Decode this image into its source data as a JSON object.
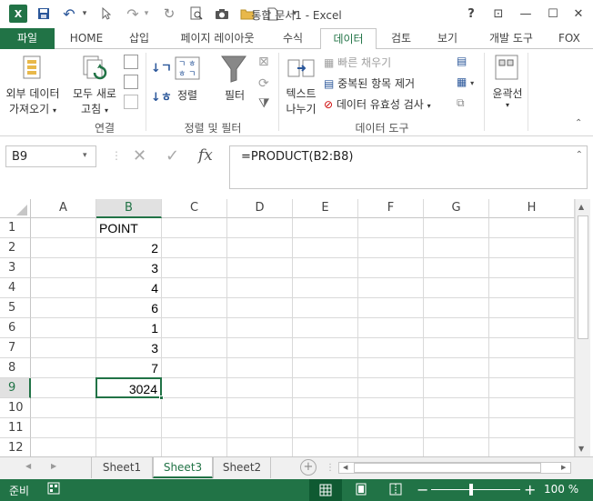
{
  "window": {
    "title": "통합 문서1 - Excel"
  },
  "qat": {
    "excel_icon": "X",
    "save_icon": "💾",
    "undo_icon": "↶",
    "redo_icon": "↷"
  },
  "window_controls": {
    "help": "?",
    "restore_ribbon": "⊡",
    "minimize": "—",
    "maximize": "☐",
    "close": "✕"
  },
  "tabs": [
    {
      "label": "파일"
    },
    {
      "label": "HOME"
    },
    {
      "label": "삽입"
    },
    {
      "label": "페이지 레이아웃"
    },
    {
      "label": "수식"
    },
    {
      "label": "데이터"
    },
    {
      "label": "검토"
    },
    {
      "label": "보기"
    },
    {
      "label": "개발 도구"
    },
    {
      "label": "FOX"
    }
  ],
  "ribbon": {
    "external_data": {
      "line1": "외부 데이터",
      "line2": "가져오기"
    },
    "refresh_all": {
      "line1": "모두 새로",
      "line2": "고침"
    },
    "sort": "정렬",
    "filter": "필터",
    "text_to_columns": {
      "line1": "텍스트",
      "line2": "나누기"
    },
    "flash_fill": "빠른 채우기",
    "remove_duplicates": "중복된 항목 제거",
    "data_validation": "데이터 유효성 검사",
    "outline": "윤곽선",
    "groups": {
      "connections": "연결",
      "sort_filter": "정렬 및 필터",
      "data_tools": "데이터 도구"
    }
  },
  "formula_bar": {
    "name_box": "B9",
    "formula": "=PRODUCT(B2:B8)",
    "cancel": "✕",
    "enter": "✓",
    "fx": "fx"
  },
  "grid": {
    "columns": [
      "A",
      "B",
      "C",
      "D",
      "E",
      "F",
      "G",
      "H"
    ],
    "rows": [
      "1",
      "2",
      "3",
      "4",
      "5",
      "6",
      "7",
      "8",
      "9",
      "10",
      "11",
      "12"
    ],
    "b_values": [
      "POINT",
      "2",
      "3",
      "4",
      "6",
      "1",
      "3",
      "7",
      "3024",
      "",
      "",
      ""
    ]
  },
  "sheets": [
    {
      "label": "Sheet1"
    },
    {
      "label": "Sheet3"
    },
    {
      "label": "Sheet2"
    }
  ],
  "status": {
    "ready": "준비",
    "zoom": "100 %"
  },
  "colors": {
    "accent": "#217346"
  }
}
